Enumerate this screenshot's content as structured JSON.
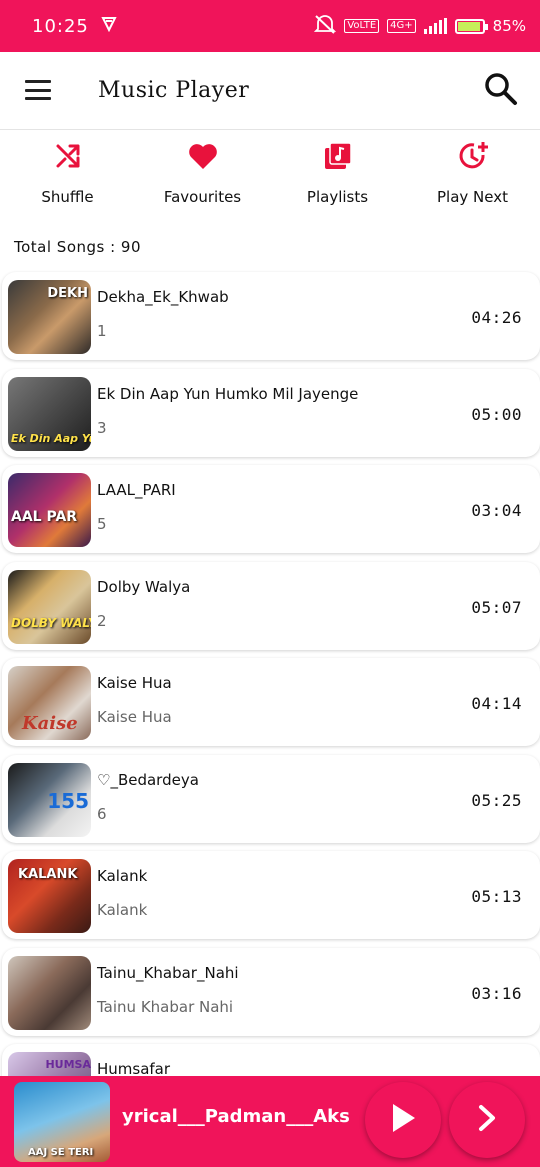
{
  "status_bar": {
    "time": "10:25",
    "network_badge": "4G+",
    "lte_badge": "VoLTE",
    "battery_percent": "85%",
    "battery_level": 0.85,
    "icons": [
      "vpn-icon",
      "mute-icon",
      "signal-icon",
      "battery-icon"
    ]
  },
  "app_bar": {
    "title": "Music Player",
    "menu_icon": "menu-icon",
    "search_icon": "search-icon"
  },
  "actions": [
    {
      "label": "Shuffle",
      "icon": "shuffle-icon"
    },
    {
      "label": "Favourites",
      "icon": "heart-icon"
    },
    {
      "label": "Playlists",
      "icon": "playlist-icon"
    },
    {
      "label": "Play Next",
      "icon": "play-next-clock-icon"
    }
  ],
  "total_songs_label": "Total Songs : 90",
  "songs": [
    {
      "title": "Dekha_Ek_Khwab",
      "subtitle": "1",
      "duration": "04:26",
      "thumb_text": "DEKH"
    },
    {
      "title": "Ek Din Aap Yun Humko Mil Jayenge",
      "subtitle": "3",
      "duration": "05:00",
      "thumb_text": "Ek Din Aap Yun"
    },
    {
      "title": "LAAL_PARI",
      "subtitle": "5",
      "duration": "03:04",
      "thumb_text": "AAL PAR"
    },
    {
      "title": "Dolby Walya",
      "subtitle": "2",
      "duration": "05:07",
      "thumb_text": "DOLBY WALYA"
    },
    {
      "title": "Kaise Hua",
      "subtitle": "Kaise Hua",
      "duration": "04:14",
      "thumb_text": "Kaise"
    },
    {
      "title": "♡_Bedardeya",
      "subtitle": "6",
      "duration": "05:25",
      "thumb_text": "155"
    },
    {
      "title": "Kalank",
      "subtitle": "Kalank",
      "duration": "05:13",
      "thumb_text": "KALANK"
    },
    {
      "title": "Tainu_Khabar_Nahi",
      "subtitle": "Tainu Khabar Nahi",
      "duration": "03:16",
      "thumb_text": ""
    },
    {
      "title": "Humsafar",
      "subtitle": "",
      "duration": "",
      "thumb_text": "HUMSA"
    }
  ],
  "mini_player": {
    "title": "yrical___Padman___Aks",
    "thumb_text": "AAJ SE TERI",
    "play_icon": "play-icon",
    "next_icon": "next-icon"
  },
  "colors": {
    "accent": "#f0145a",
    "icon_red": "#e8123c"
  }
}
